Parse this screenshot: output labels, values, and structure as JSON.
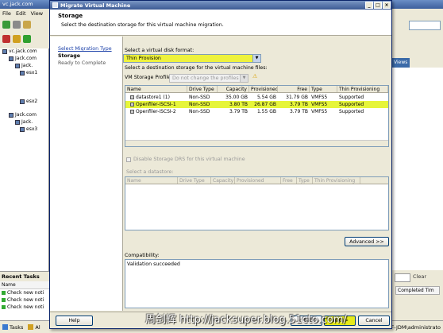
{
  "background_app": {
    "title": "vc.jack.com",
    "menu": [
      "File",
      "Edit",
      "View"
    ],
    "tree": [
      {
        "label": "vc.jack.com"
      },
      {
        "label": "Jack.com"
      },
      {
        "label": "Jack."
      },
      {
        "label": "esx1"
      },
      {
        "label": "esx2"
      },
      {
        "label": "Jack.com"
      },
      {
        "label": "Jack."
      },
      {
        "label": "esx3"
      }
    ],
    "recent_tasks": {
      "title": "Recent Tasks",
      "col_name": "Name",
      "rows": [
        "Check new noti",
        "Check new noti",
        "Check new noti"
      ]
    },
    "right_panel": {
      "views_tab": "Views",
      "clear_label": "Clear",
      "completed_col": "Completed Tim"
    },
    "statusbar": {
      "tasks_label": "Tasks",
      "alarms_label": "Al",
      "user": "F-JDM\\administrato"
    }
  },
  "dialog": {
    "title": "Migrate Virtual Machine",
    "window_buttons": [
      "_",
      "□",
      "×"
    ],
    "header": {
      "title": "Storage",
      "description": "Select the destination storage for this virtual machine migration."
    },
    "steps": [
      {
        "label": "Select Migration Type",
        "state": "link"
      },
      {
        "label": "Storage",
        "state": "current"
      },
      {
        "label": "Ready to Complete",
        "state": "pending"
      }
    ],
    "disk_format_label": "Select a virtual disk format:",
    "disk_format_value": "Thin Provision",
    "dest_storage_label": "Select a destination storage for the virtual machine files:",
    "vm_profile_label": "VM Storage Profile:",
    "vm_profile_value": "Do not change the profiles",
    "datastore_table": {
      "columns": [
        "Name",
        "Drive Type",
        "Capacity",
        "Provisioned",
        "Free",
        "Type",
        "Thin Provisioning"
      ],
      "rows": [
        {
          "name": "datastore1 (1)",
          "drive_type": "Non-SSD",
          "capacity": "35.00 GB",
          "provisioned": "5.54 GB",
          "free": "31.79 GB",
          "type": "VMFS5",
          "thin": "Supported",
          "selected": false
        },
        {
          "name": "Openfiler-iSCSI-1",
          "drive_type": "Non-SSD",
          "capacity": "3.80 TB",
          "provisioned": "26.87 GB",
          "free": "3.79 TB",
          "type": "VMFS5",
          "thin": "Supported",
          "selected": true
        },
        {
          "name": "Openfiler-iSCSI-2",
          "drive_type": "Non-SSD",
          "capacity": "3.79 TB",
          "provisioned": "1.55 GB",
          "free": "3.79 TB",
          "type": "VMFS5",
          "thin": "Supported",
          "selected": false
        }
      ]
    },
    "disable_drs_label": "Disable Storage DRS for this virtual machine",
    "select_datastore_label": "Select a datastore:",
    "datastore_table2_columns": [
      "Name",
      "Drive Type",
      "Capacity",
      "Provisioned",
      "Free",
      "Type",
      "Thin Provisioning"
    ],
    "advanced_button": "Advanced >>",
    "compatibility_label": "Compatibility:",
    "compatibility_value": "Validation succeeded",
    "help_button": "Help",
    "back_button": "< Back",
    "next_button": "Next >",
    "cancel_button": "Cancel"
  },
  "watermark": "周剑辉 http://jacksuper.blog.51cto.com/",
  "colors": {
    "highlight": "#eef23c",
    "title_bar": "#3c5a94",
    "selected_row": "#e6f53a"
  }
}
